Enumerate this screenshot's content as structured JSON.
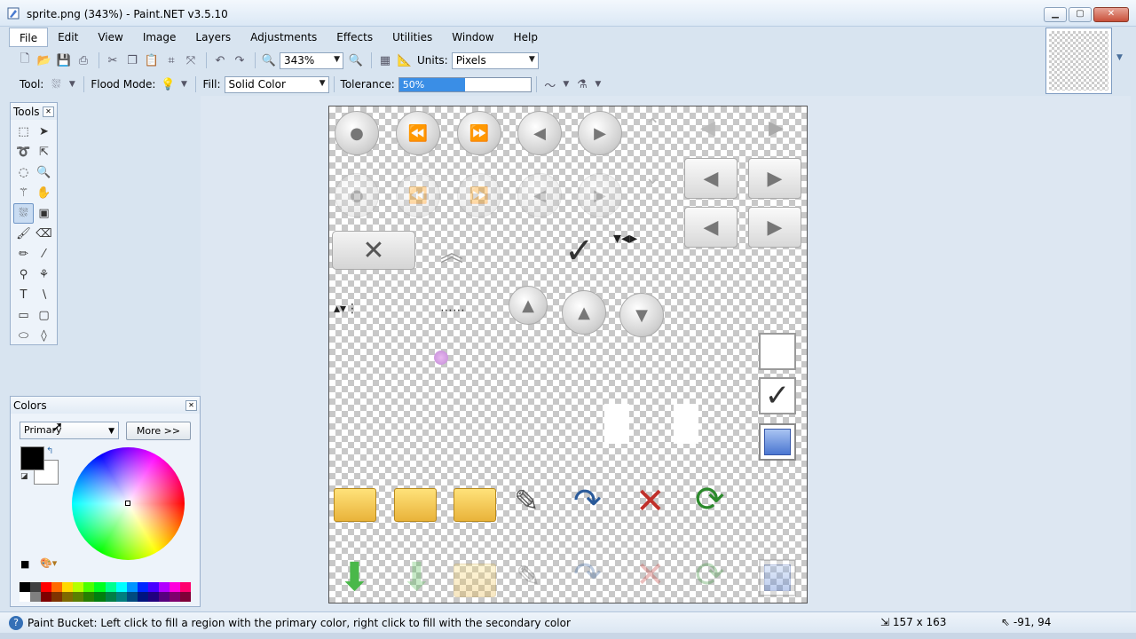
{
  "window": {
    "title": "sprite.png (343%) - Paint.NET v3.5.10",
    "min_icon": "minimize-icon",
    "max_icon": "maximize-icon",
    "close_icon": "close-icon"
  },
  "menu": [
    "File",
    "Edit",
    "View",
    "Image",
    "Layers",
    "Adjustments",
    "Effects",
    "Utilities",
    "Window",
    "Help"
  ],
  "toolbar": {
    "zoom_value": "343%",
    "units_label": "Units:",
    "units_value": "Pixels"
  },
  "tool_options": {
    "tool_label": "Tool:",
    "flood_mode_label": "Flood Mode:",
    "fill_label": "Fill:",
    "fill_value": "Solid Color",
    "tolerance_label": "Tolerance:",
    "tolerance_value": "50%",
    "tolerance_fraction": 0.5
  },
  "tools_panel": {
    "title": "Tools",
    "tools": [
      "rectangle-select-icon",
      "move-selection-icon",
      "lasso-select-icon",
      "move-selected-icon",
      "ellipse-select-icon",
      "zoom-icon",
      "magic-wand-icon",
      "pan-icon",
      "paint-bucket-icon",
      "gradient-icon",
      "paintbrush-icon",
      "eraser-icon",
      "pencil-icon",
      "color-picker-icon",
      "clone-stamp-icon",
      "recolor-icon",
      "text-icon",
      "line-curve-icon",
      "rectangle-icon",
      "rounded-rectangle-icon",
      "ellipse-icon",
      "freeform-shape-icon"
    ],
    "selected_tool": "paint-bucket-icon"
  },
  "colors_panel": {
    "title": "Colors",
    "selector_value": "Primary",
    "more_button": "More >>",
    "primary_color": "#000000",
    "secondary_color": "#ffffff",
    "palette": [
      "#000000",
      "#404040",
      "#ff0000",
      "#ff6a00",
      "#ffd800",
      "#b6ff00",
      "#4cff00",
      "#00ff21",
      "#00ff90",
      "#00ffff",
      "#0094ff",
      "#0026ff",
      "#4800ff",
      "#b200ff",
      "#ff00dc",
      "#ff006e",
      "#ffffff",
      "#808080",
      "#7f0000",
      "#7f3300",
      "#7f6a00",
      "#5b7f00",
      "#267f00",
      "#007f0e",
      "#007f46",
      "#007f7f",
      "#004a7f",
      "#00137f",
      "#21007f",
      "#57007f",
      "#7f006e",
      "#7f0037"
    ]
  },
  "status": {
    "message": "Paint Bucket: Left click to fill a region with the primary color, right click to fill with the secondary color",
    "image_size": "157 x 163",
    "cursor_pos": "-91, 94"
  }
}
